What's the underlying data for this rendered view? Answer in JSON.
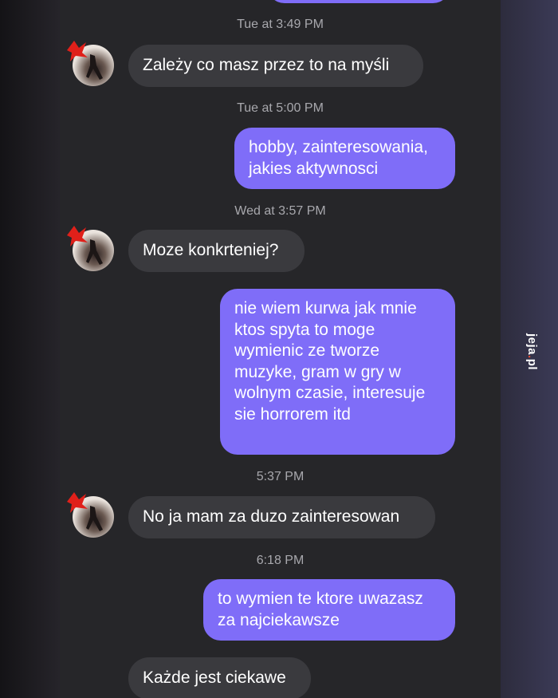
{
  "conversation": {
    "messages": [
      {
        "timestamp": "Tue at 3:49 PM",
        "direction": "in",
        "text": "Zależy co masz przez to na myśli"
      },
      {
        "timestamp": "Tue at 5:00 PM",
        "direction": "out",
        "text": "hobby, zainteresowania,\njakies aktywnosci"
      },
      {
        "timestamp": "Wed at 3:57 PM",
        "direction": "in",
        "text": "Moze konkrteniej?"
      },
      {
        "timestamp": "",
        "direction": "out",
        "text": "nie wiem kurwa jak mnie\nktos spyta to moge\nwymienic ze tworze\nmuzyke, gram w gry w\nwolnym czasie, interesuje\nsie horrorem itd"
      },
      {
        "timestamp": "5:37 PM",
        "direction": "in",
        "text": "No ja mam za duzo zainteresowan"
      },
      {
        "timestamp": "6:18 PM",
        "direction": "out",
        "text": "to wymien te ktore uwazasz\nza najciekawsze"
      },
      {
        "timestamp": "",
        "direction": "in",
        "text": "Każde jest ciekawe"
      }
    ]
  },
  "watermark": {
    "brand": "jeja",
    "dot": ".",
    "tld": "pl"
  },
  "colors": {
    "outgoing_bubble": "#7f6df8",
    "incoming_bubble": "#3a3a3e",
    "background": "#262629"
  }
}
